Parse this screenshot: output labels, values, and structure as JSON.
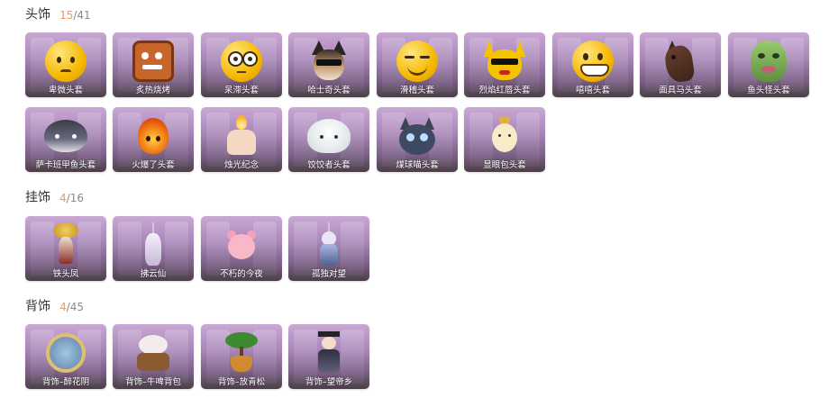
{
  "sections": [
    {
      "title": "头饰",
      "owned": "15",
      "total": "41",
      "items": [
        {
          "label": "卑微头套",
          "icon": "humble-face-icon"
        },
        {
          "label": "炙热烧烤",
          "icon": "toast-bread-icon"
        },
        {
          "label": "呆滞头套",
          "icon": "dazed-face-icon"
        },
        {
          "label": "哈士奇头套",
          "icon": "husky-dog-icon"
        },
        {
          "label": "滑稽头套",
          "icon": "funny-face-icon"
        },
        {
          "label": "烈焰红唇头套",
          "icon": "red-lips-pikachu-icon"
        },
        {
          "label": "嘻嘻头套",
          "icon": "grinning-face-icon"
        },
        {
          "label": "面具马头套",
          "icon": "horse-mask-icon"
        },
        {
          "label": "鱼头怪头套",
          "icon": "fish-monster-icon"
        },
        {
          "label": "萨卡班甲鱼头套",
          "icon": "sacabambaspis-icon"
        },
        {
          "label": "火爆了头套",
          "icon": "fire-spirit-icon"
        },
        {
          "label": "烛光纪念",
          "icon": "candle-icon"
        },
        {
          "label": "饺饺者头套",
          "icon": "dumpling-icon"
        },
        {
          "label": "煤球喵头套",
          "icon": "coal-cat-icon"
        },
        {
          "label": "显眼包头套",
          "icon": "bun-icon"
        }
      ]
    },
    {
      "title": "挂饰",
      "owned": "4",
      "total": "16",
      "items": [
        {
          "label": "铁头凤",
          "icon": "phoenix-charm-icon"
        },
        {
          "label": "拂云仙",
          "icon": "cloud-fairy-charm-icon"
        },
        {
          "label": "不朽的今夜",
          "icon": "pink-bear-charm-icon"
        },
        {
          "label": "孤独对望",
          "icon": "lonely-gaze-charm-icon"
        }
      ]
    },
    {
      "title": "背饰",
      "owned": "4",
      "total": "45",
      "items": [
        {
          "label": "背饰–醉花阴",
          "icon": "flower-wheel-back-icon"
        },
        {
          "label": "背饰–牛啤背包",
          "icon": "cow-backpack-icon"
        },
        {
          "label": "背饰–放青松",
          "icon": "bonsai-pine-back-icon"
        },
        {
          "label": "背饰–望帝乡",
          "icon": "emperor-figure-back-icon"
        }
      ]
    }
  ],
  "colors": {
    "owned_count": "#e89a6a",
    "total_count": "#888888",
    "card_top": "#c9a8d4",
    "card_bottom": "#4a3f45"
  }
}
